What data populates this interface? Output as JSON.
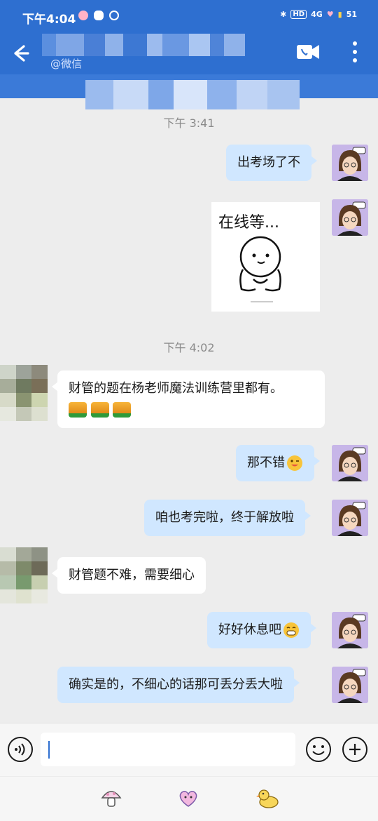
{
  "status": {
    "time": "下午4:04",
    "network": "4G",
    "battery": "51"
  },
  "header": {
    "subtitle": "@微信"
  },
  "chat": {
    "timestamps": [
      "下午 3:41",
      "下午 4:02"
    ],
    "messages": [
      {
        "from": "me",
        "text": "出考场了不"
      },
      {
        "from": "me",
        "sticker": "在线等..."
      },
      {
        "from": "other",
        "text": "财管的题在杨老师魔法训练营里都有。",
        "emoji": "thumbs-up x3"
      },
      {
        "from": "me",
        "text": "那不错",
        "emoji": "wink-tongue-emoji"
      },
      {
        "from": "me",
        "text": "咱也考完啦，终于解放啦"
      },
      {
        "from": "other",
        "text": "财管题不难，需要细心"
      },
      {
        "from": "me",
        "text": "好好休息吧",
        "emoji": "grin-emoji"
      },
      {
        "from": "me",
        "text": "确实是的，不细心的话那可丢分丢大啦"
      }
    ]
  },
  "colors": {
    "header": "#2e6fd0",
    "outgoing_bubble": "#d0e7ff",
    "incoming_bubble": "#ffffff",
    "background": "#ededed"
  }
}
